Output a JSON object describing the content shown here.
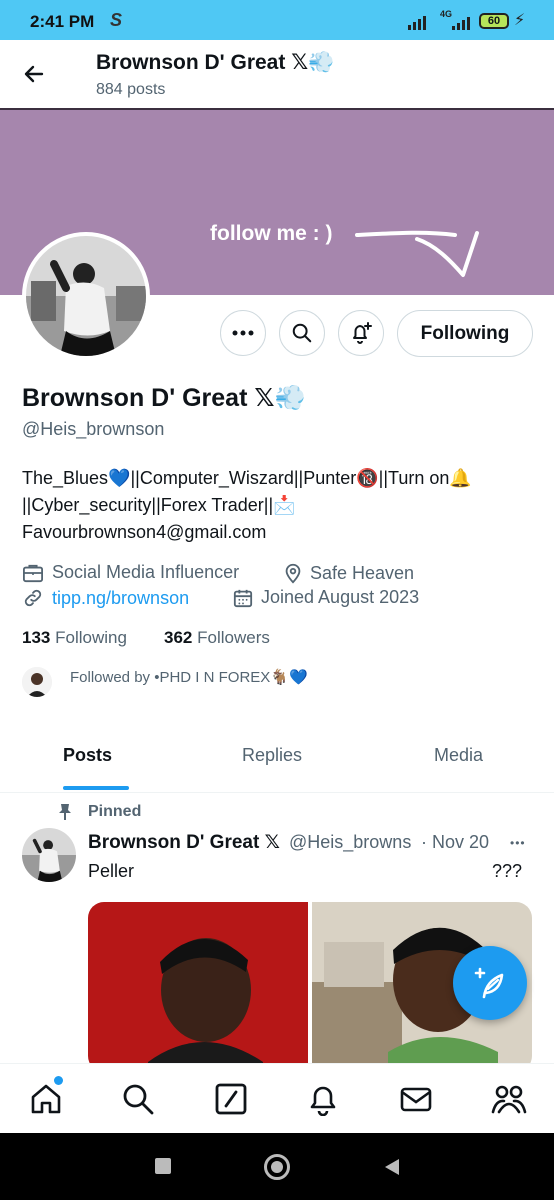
{
  "status_bar": {
    "time": "2:41 PM",
    "app_icon": "S",
    "network": "4G",
    "battery": "60"
  },
  "header": {
    "title": "Brownson D' Great",
    "posts_count": "884 posts",
    "x_icon": "𝕏",
    "emoji": "💨"
  },
  "banner": {
    "text": "follow me : )",
    "color": "#a686ad"
  },
  "actions": {
    "following_label": "Following"
  },
  "profile": {
    "name": "Brownson D' Great",
    "x_icon": "𝕏",
    "emoji": "💨",
    "handle": "@Heis_brownson",
    "bio_line1": "The_Blues💙||Computer_Wiszard||Punter🔞||Turn on🔔",
    "bio_line2": "||Cyber_security||Forex Trader||📩",
    "bio_line3": "Favourbrownson4@gmail.com",
    "category": "Social Media Influencer",
    "location": "Safe Heaven",
    "website": "tipp.ng/brownson",
    "joined": "Joined August 2023",
    "following_count": "133",
    "following_label": "Following",
    "followers_count": "362",
    "followers_label": "Followers",
    "followed_by": "Followed by •PHD I N FOREX🐐💙"
  },
  "tabs": [
    {
      "label": "Posts",
      "active": true
    },
    {
      "label": "Replies",
      "active": false
    },
    {
      "label": "Media",
      "active": false
    }
  ],
  "tweet": {
    "pinned_label": "Pinned",
    "author": "Brownson D' Great",
    "x_icon": "𝕏",
    "handle": "@Heis_browns",
    "date": "· Nov 20",
    "more": "•••",
    "text": "Peller",
    "extra": "???"
  },
  "colors": {
    "accent": "#1d9bf0",
    "statusbar": "#4fc8f4",
    "secondary_text": "#536471"
  }
}
